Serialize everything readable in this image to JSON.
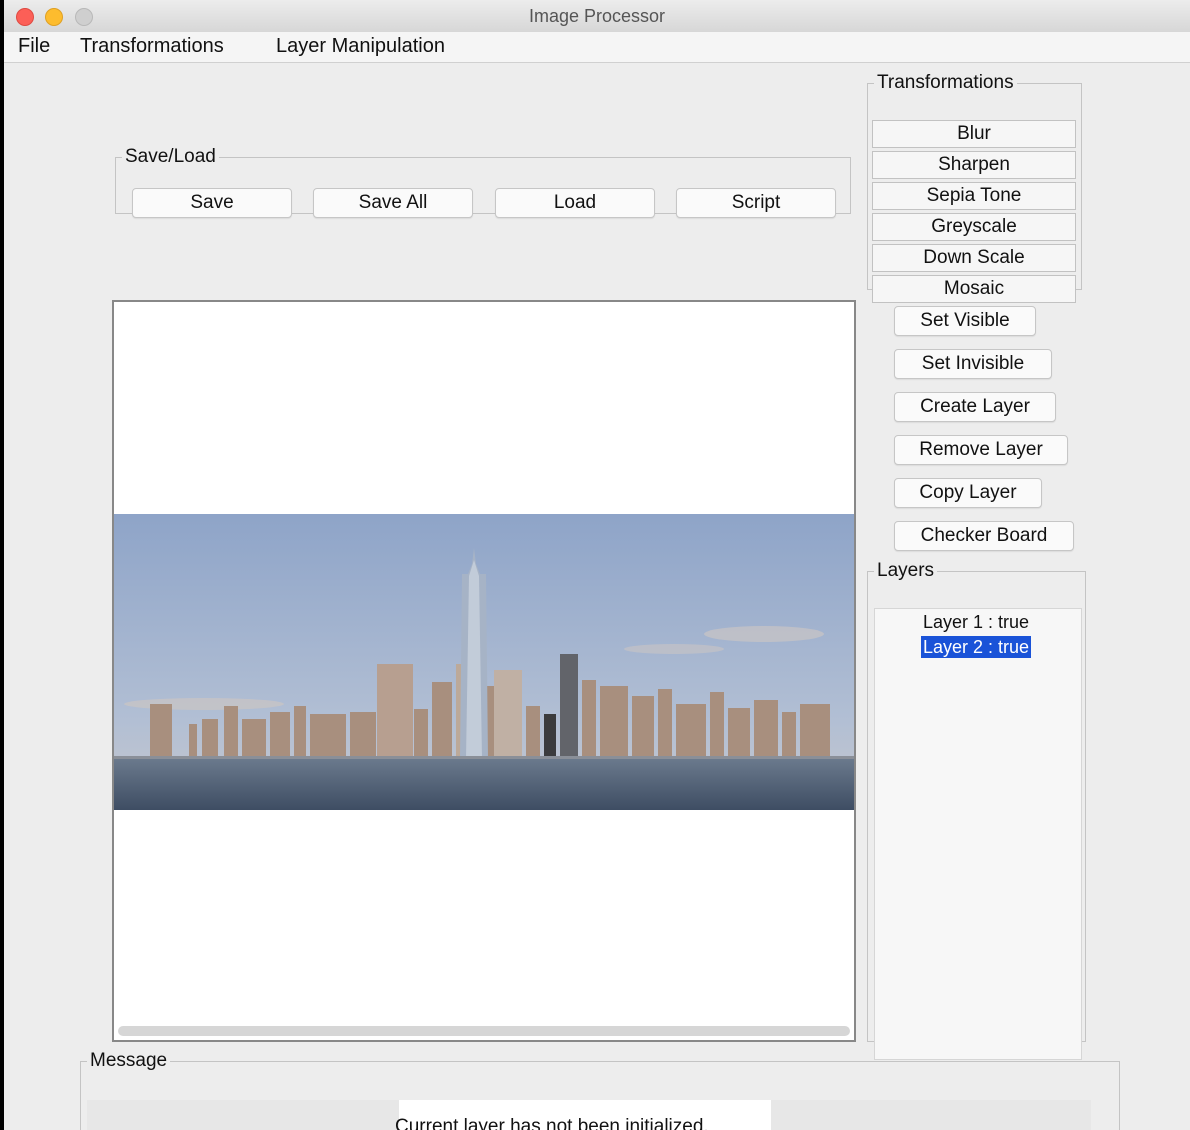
{
  "window": {
    "title": "Image Processor"
  },
  "menu": {
    "file": "File",
    "transformations": "Transformations",
    "layer_manipulation": "Layer Manipulation"
  },
  "save_load": {
    "legend": "Save/Load",
    "buttons": [
      "Save",
      "Save All",
      "Load",
      "Script"
    ]
  },
  "transformations_panel": {
    "legend": "Transformations",
    "buttons": [
      "Blur",
      "Sharpen",
      "Sepia Tone",
      "Greyscale",
      "Down Scale",
      "Mosaic"
    ]
  },
  "layer_buttons": [
    "Set Visible",
    "Set Invisible",
    "Create Layer",
    "Remove Layer",
    "Copy Layer",
    "Checker Board"
  ],
  "layers_panel": {
    "legend": "Layers",
    "items": [
      {
        "label": "Layer 1 : true",
        "selected": false
      },
      {
        "label": "Layer 2 : true",
        "selected": true
      }
    ]
  },
  "message_panel": {
    "legend": "Message",
    "text": "Current layer has not been initialized."
  },
  "colors": {
    "selection": "#1a53d8",
    "close": "#fc5f57",
    "minimize": "#fdbc2e",
    "maximize": "#cfcfcf"
  }
}
